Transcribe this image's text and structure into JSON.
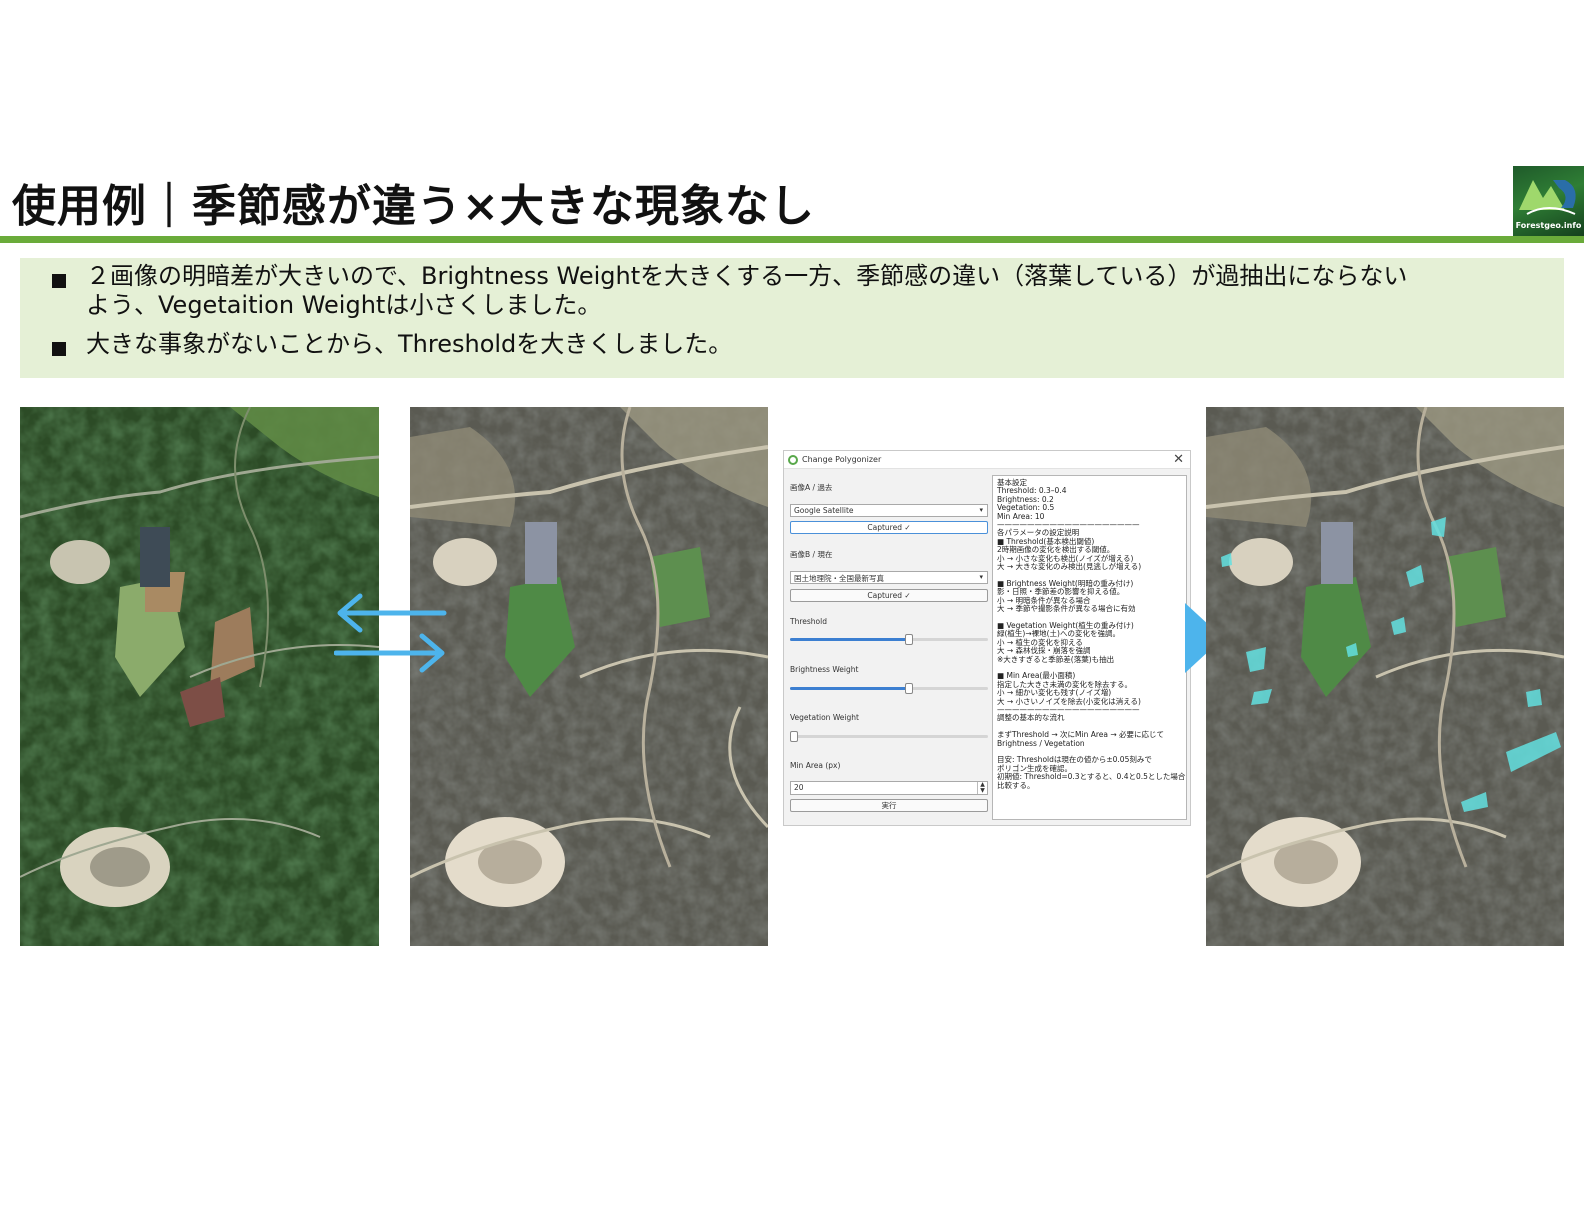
{
  "slide": {
    "title": "使用例｜季節感が違う×大きな現象なし",
    "logo_text": "Forestgeo.info",
    "bullets": [
      {
        "line1": "２画像の明暗差が大きいので、Brightness Weightを大きくする一方、季節感の違い（落葉している）が過抽出にならない",
        "line2": "よう、Vegetaition Weightは小さくしました。"
      },
      {
        "line1": "大きな事象がないことから、Thresholdを大きくしました。"
      }
    ]
  },
  "dialog": {
    "title": "Change Polygonizer",
    "close_label": "✕",
    "image_a_label": "画像A / 過去",
    "image_a_value": "Google Satellite",
    "captured_a": "Captured ✓",
    "image_b_label": "画像B / 現在",
    "image_b_value": "国土地理院・全国最新写真",
    "captured_b": "Captured ✓",
    "threshold_label": "Threshold",
    "threshold_level": 0.6,
    "brightness_label": "Brightness Weight",
    "brightness_level": 0.6,
    "vegetation_label": "Vegetation Weight",
    "vegetation_level": 0.0,
    "min_area_label": "Min Area (px)",
    "min_area_value": "20",
    "run_label": "実行",
    "help_lines": [
      "基本設定",
      "Threshold: 0.3–0.4",
      "Brightness: 0.2",
      "Vegetation: 0.5",
      "Min Area: 10",
      "———————————————————",
      "各パラメータの設定説明",
      "■ Threshold(基本検出閾値)",
      "2時期画像の変化を検出する閾値。",
      "小 → 小さな変化も検出(ノイズが増える)",
      "大 → 大きな変化のみ検出(見逃しが増える)",
      "",
      "■ Brightness Weight(明暗の重み付け)",
      "影・日照・季節差の影響を抑える値。",
      "小 → 明暗条件が異なる場合",
      "大 → 季節や撮影条件が異なる場合に有効",
      "",
      "■ Vegetation Weight(植生の重み付け)",
      "緑(植生)→裸地(土)への変化を強調。",
      "小 → 植生の変化を抑える",
      "大 → 森林伐採・崩落を強調",
      "※大きすぎると季節差(落葉)も抽出",
      "",
      "■ Min Area(最小面積)",
      "指定した大きさ未満の変化を除去する。",
      "小 → 細かい変化も残す(ノイズ増)",
      "大 → 小さいノイズを除去(小変化は消える)",
      "———————————————————",
      "調整の基本的な流れ",
      "",
      "まずThreshold → 次にMin Area → 必要に応じて",
      "Brightness / Vegetation",
      "",
      "目安: Thresholdは現在の値から±0.05刻みで",
      "ポリゴン生成を確認。",
      "初期値: Threshold=0.3とすると、0.4と0.5とした場合も",
      "比較する。"
    ]
  },
  "colors": {
    "accent_green": "#6aab3a",
    "bullet_bg": "#e5f0d6",
    "arrow_blue": "#4db4ec",
    "change_cyan": "#63e0e0"
  }
}
